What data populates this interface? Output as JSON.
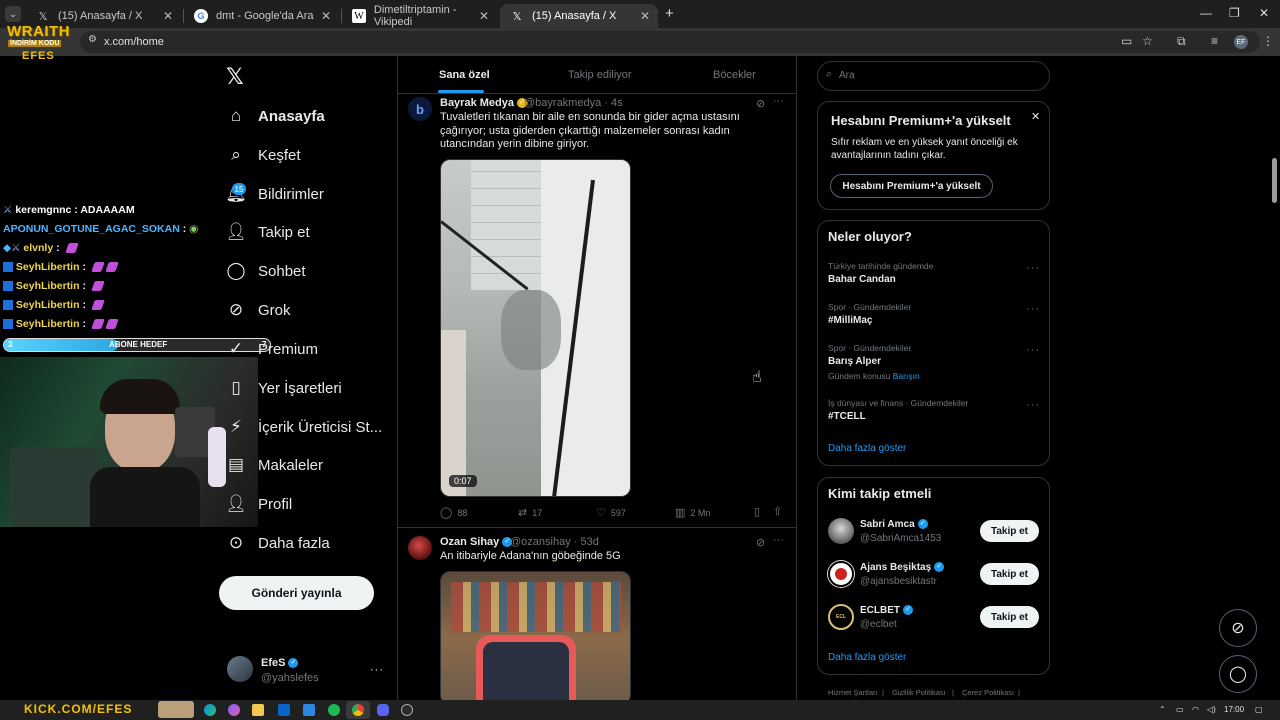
{
  "browser": {
    "tabs": [
      {
        "title": "(15) Anasayfa / X",
        "icon": "x-logo-icon",
        "active": false
      },
      {
        "title": "dmt - Google'da Ara",
        "icon": "google-icon",
        "active": false
      },
      {
        "title": "Dimetiltriptamin - Vikipedi",
        "icon": "wikipedia-icon",
        "active": false
      },
      {
        "title": "(15) Anasayfa / X",
        "icon": "x-logo-icon",
        "active": true
      }
    ],
    "url": "x.com/home"
  },
  "stream_overlay": {
    "logo": {
      "title": "WRAITH",
      "subtitle": "İNDİRİM KODU",
      "code": "EFES"
    },
    "chat": [
      {
        "user": "keremgnnc",
        "message": "ADAAAAM",
        "user_color": "white"
      },
      {
        "user": "APONUN_GOTUNE_AGAC_SOKAN",
        "message": "",
        "user_color": "blue"
      },
      {
        "user": "elvnly",
        "message": "",
        "user_color": "yellow"
      },
      {
        "user": "SeyhLibertin",
        "message": "",
        "user_color": "yellow"
      },
      {
        "user": "SeyhLibertin",
        "message": "",
        "user_color": "yellow"
      },
      {
        "user": "SeyhLibertin",
        "message": "",
        "user_color": "yellow"
      },
      {
        "user": "SeyhLibertin",
        "message": "",
        "user_color": "yellow"
      }
    ],
    "sub_goal": {
      "count": "3",
      "label": "ABONE HEDEF",
      "target": "7",
      "progress": 0.43
    },
    "ticker_text": "KICK.COM/EFES"
  },
  "nav": {
    "items": [
      {
        "label": "Anasayfa",
        "icon": "home-icon",
        "bold": true
      },
      {
        "label": "Keşfet",
        "icon": "search-icon"
      },
      {
        "label": "Bildirimler",
        "icon": "bell-icon",
        "badge": "15"
      },
      {
        "label": "Takip et",
        "icon": "add-user-icon"
      },
      {
        "label": "Sohbet",
        "icon": "chat-icon"
      },
      {
        "label": "Grok",
        "icon": "grok-icon"
      },
      {
        "label": "Premium",
        "icon": "premium-icon"
      },
      {
        "label": "Yer İşaretleri",
        "icon": "bookmark-icon"
      },
      {
        "label": "İçerik Üreticisi St...",
        "icon": "creator-studio-icon"
      },
      {
        "label": "Makaleler",
        "icon": "articles-icon"
      },
      {
        "label": "Profil",
        "icon": "profile-icon"
      },
      {
        "label": "Daha fazla",
        "icon": "more-circle-icon"
      }
    ],
    "post_button": "Gönderi yayınla",
    "account": {
      "name": "EfeS",
      "handle": "@yahslefes"
    }
  },
  "timeline": {
    "tabs": [
      "Sana özel",
      "Takip ediliyor",
      "Böcekler"
    ],
    "posts": [
      {
        "name": "Bayrak Medya",
        "handle": "@bayrakmedya",
        "time": "4s",
        "text": "Tuvaletleri tıkanan bir aile en sonunda bir gider açma ustasını çağırıyor; usta giderden çıkarttığı malzemeler sonrası kadın utancından yerin dibine giriyor.",
        "video_duration": "0:07",
        "replies": "88",
        "reposts": "17",
        "likes": "597",
        "views": "2 Mn"
      },
      {
        "name": "Ozan Sihay",
        "handle": "@ozansihay",
        "time": "53d",
        "text": "An itibariyle Adana'nın göbeğinde 5G"
      }
    ]
  },
  "right": {
    "search_placeholder": "Ara",
    "premium": {
      "title": "Hesabını Premium+'a yükselt",
      "body": "Sıfır reklam ve en yüksek yanıt önceliği ek avantajlarının tadını çıkar.",
      "button": "Hesabını Premium+'a yükselt"
    },
    "trends": {
      "title": "Neler oluyor?",
      "items": [
        {
          "context": "Türkiye tarihinde gündemde",
          "name": "Bahar Candan"
        },
        {
          "context": "Spor · Gündemdekiler",
          "name": "#MilliMaç"
        },
        {
          "context": "Spor · Gündemdekiler",
          "name": "Barış Alper",
          "topic_prefix": "Gündem konusu",
          "topic": "Barışın"
        },
        {
          "context": "İş dünyası ve finans · Gündemdekiler",
          "name": "#TCELL"
        }
      ],
      "show_more": "Daha fazla göster"
    },
    "who_to_follow": {
      "title": "Kimi takip etmeli",
      "items": [
        {
          "name": "Sabri Amca",
          "handle": "@SabriAmca1453"
        },
        {
          "name": "Ajans Beşiktaş",
          "handle": "@ajansbesiktastr"
        },
        {
          "name": "ECLBET",
          "handle": "@eclbet"
        }
      ],
      "button": "Takip et",
      "show_more": "Daha fazla göster"
    },
    "footer": [
      "Hizmet Şartları",
      "Gizlilik Politikası",
      "Çerez Politikası"
    ]
  },
  "system": {
    "clock": "17:00"
  }
}
